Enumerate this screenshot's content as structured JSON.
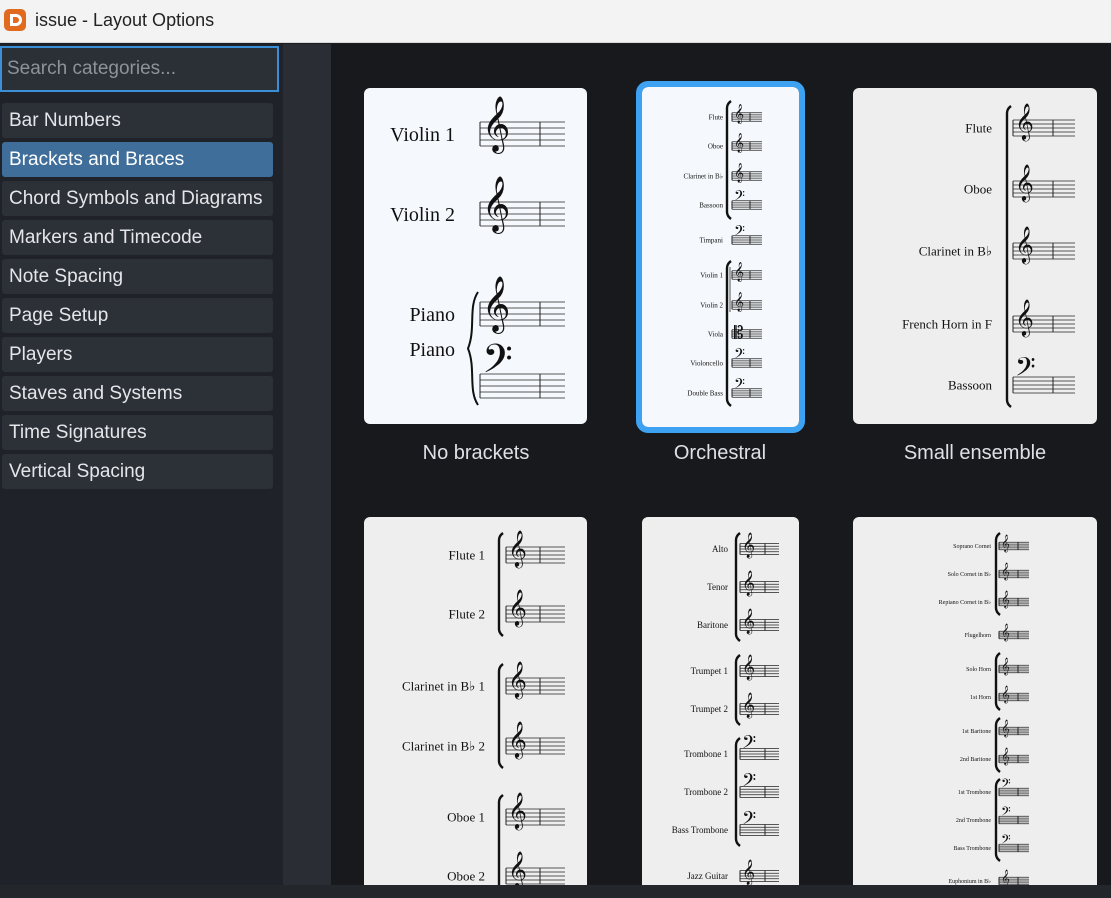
{
  "window": {
    "title": "issue - Layout Options",
    "app_icon": "dorico-logo-icon"
  },
  "search": {
    "placeholder": "Search categories..."
  },
  "categories": [
    "Bar Numbers",
    "Brackets and Braces",
    "Chord Symbols and Diagrams",
    "Markers and Timecode",
    "Note Spacing",
    "Page Setup",
    "Players",
    "Staves and Systems",
    "Time Signatures",
    "Vertical Spacing"
  ],
  "selected_category": "Brackets and Braces",
  "colors": {
    "accent": "#3ea2f2",
    "selected_category_bg": "#3e6e99",
    "card_bg": "#eeeeee"
  },
  "options": [
    {
      "label": "No brackets",
      "selected": false,
      "staves": [
        "Violin 1",
        "Violin 2",
        "Piano"
      ]
    },
    {
      "label": "Orchestral",
      "selected": true,
      "staves": [
        "Flute",
        "Oboe",
        "Clarinet in B♭",
        "Bassoon",
        "Timpani",
        "Violin 1",
        "Violin 2",
        "Viola",
        "Violoncello",
        "Double Bass"
      ]
    },
    {
      "label": "Small ensemble",
      "selected": false,
      "staves": [
        "Flute",
        "Oboe",
        "Clarinet in B♭",
        "French Horn in F",
        "Bassoon"
      ]
    },
    {
      "label": "",
      "selected": false,
      "staves": [
        "Flute 1",
        "Flute 2",
        "Clarinet in B♭ 1",
        "Clarinet in B♭ 2",
        "Oboe 1",
        "Oboe 2"
      ]
    },
    {
      "label": "",
      "selected": false,
      "staves": [
        "Alto",
        "Tenor",
        "Baritone",
        "Trumpet 1",
        "Trumpet 2",
        "Trombone 1",
        "Trombone 2",
        "Bass Trombone",
        "Jazz Guitar"
      ]
    },
    {
      "label": "",
      "selected": false,
      "staves": [
        "Soprano Cornet",
        "Solo Cornet in B♭",
        "Repiano Cornet in B♭",
        "Flugelhorn",
        "Solo Horn",
        "1st Horn",
        "1st Baritone",
        "2nd Baritone",
        "1st Trombone",
        "2nd Trombone",
        "Bass Trombone",
        "Euphonium in B♭"
      ]
    }
  ]
}
